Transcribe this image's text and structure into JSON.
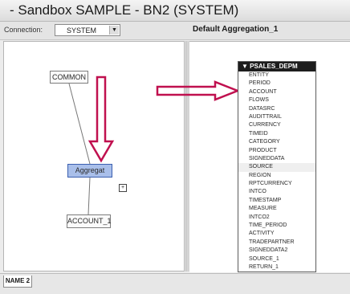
{
  "window": {
    "title": "- Sandbox SAMPLE - BN2 (SYSTEM)"
  },
  "toolbar": {
    "label": "Connection:",
    "select_value": "SYSTEM"
  },
  "section": {
    "title": "Default Aggregation_1"
  },
  "tree": {
    "nodes": [
      "COMMON",
      "Aggregat",
      "ACCOUNT_1"
    ],
    "expander": "+"
  },
  "column_list": {
    "header": "PSALES_DEPM",
    "items": [
      "ENTITY",
      "PERIOD",
      "ACCOUNT",
      "FLOWS",
      "DATASRC",
      "AUDITTRAIL",
      "CURRENCY",
      "TIMEID",
      "CATEGORY",
      "PRODUCT",
      "SIGNEDDATA",
      "SOURCE",
      "REGION",
      "RPTCURRENCY",
      "INTCO",
      "TIMESTAMP",
      "MEASURE",
      "INTCO2",
      "TIME_PERIOD",
      "ACTIVITY",
      "TRADEPARTNER",
      "SIGNEDDATA2",
      "SOURCE_1",
      "RETURN_1"
    ],
    "highlighted_index": 11
  },
  "status": {
    "tab": "NAME 2"
  },
  "colors": {
    "arrow": "#c0104f",
    "node_selected": "#a9bfea",
    "header_bg": "#1d1d1d"
  }
}
